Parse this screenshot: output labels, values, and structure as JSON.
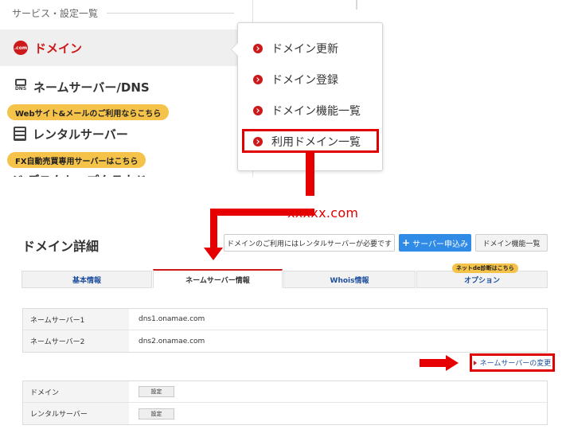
{
  "sidebar": {
    "section_title": "サービス・設定一覧",
    "items": [
      {
        "label": "ドメイン",
        "icon": "domain-com-icon",
        "icon_text": ".com"
      },
      {
        "label": "ネームサーバー/DNS",
        "icon": "dns-icon",
        "icon_text": "DNS"
      },
      {
        "label": "レンタルサーバー",
        "icon": "server-icon"
      }
    ],
    "promo_website": "Webサイト&メールのご利用ならこちら",
    "promo_fx": "FX自動売買専用サーバーはこちら",
    "cut_off_row": "ジ デスクトップクラウド"
  },
  "popover": {
    "items": [
      "ドメイン更新",
      "ドメイン登録",
      "ドメイン機能一覧",
      "利用ドメイン一覧"
    ]
  },
  "annotation": {
    "domain_label": "xxxxx.com",
    "highlight_color": "#e00000"
  },
  "detail": {
    "title": "ドメイン詳細",
    "notice": "ドメインのご利用にはレンタルサーバーが必要です",
    "server_apply_button": "サーバー申込み",
    "domain_features_button": "ドメイン機能一覧",
    "tabs": [
      "基本情報",
      "ネームサーバー情報",
      "Whois情報",
      "オプション"
    ],
    "active_tab": "ネームサーバー情報",
    "option_badge": "ネットde診断はこちら",
    "nameservers": [
      {
        "label": "ネームサーバー1",
        "value": "dns1.onamae.com"
      },
      {
        "label": "ネームサーバー2",
        "value": "dns2.onamae.com"
      }
    ],
    "ns_change_link": "ネームサーバーの変更",
    "settings": [
      {
        "label": "ドメイン",
        "button": "設定"
      },
      {
        "label": "レンタルサーバー",
        "button": "設定"
      }
    ]
  },
  "colors": {
    "brand_red": "#cc1a1a",
    "accent_blue": "#2f8be6",
    "badge_yellow": "#f5c34a"
  }
}
